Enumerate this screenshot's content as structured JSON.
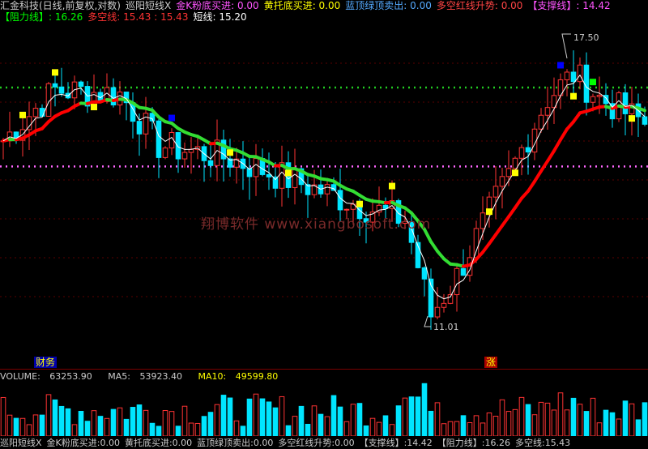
{
  "header": {
    "stock_title": "汇金科技(日线,前复权,对数)",
    "indicator_name": "巡阳短线X",
    "lines": [
      {
        "label": "金K粉底买进:",
        "value": "0.00",
        "color": "#ff55ff"
      },
      {
        "label": "黄托底买进:",
        "value": "0.00",
        "color": "#ffff00"
      },
      {
        "label": "蓝顶绿顶卖出:",
        "value": "0.00",
        "color": "#55aaff"
      },
      {
        "label": "多空红线升势:",
        "value": "0.00",
        "color": "#ff4444"
      },
      {
        "label": "【支撑线】:",
        "value": "14.42",
        "color": "#ff55ff"
      }
    ],
    "row2": [
      {
        "label": "【阻力线】:",
        "value": "16.26",
        "color": "#00ff00"
      },
      {
        "label": "多空线:",
        "value": "15.43",
        "value2": "15.43",
        "color": "#ff3333"
      },
      {
        "label": "短线:",
        "value": "15.20",
        "color": "#ffffff"
      }
    ]
  },
  "main": {
    "high_label": "17.50",
    "low_label": "11.01",
    "watermark": "翔博软件 www.xiangbosoft.com",
    "resistance_level": 16.26,
    "support_level": 14.42
  },
  "markers": {
    "left": "财务",
    "right": "涨"
  },
  "volume": {
    "label": "VOLUME:",
    "value": "63253.90",
    "ma5_label": "MA5:",
    "ma5": "53923.40",
    "ma10_label": "MA10:",
    "ma10": "49599.80"
  },
  "bottom_bar": {
    "items": [
      "巡阳短线X",
      "金K粉底买进:0.00",
      "黄托底买进:0.00",
      "蓝顶绿顶卖出:0.00",
      "多空红线升势:0.00",
      "【支撑线】:14.42",
      "【阻力线】:16.26",
      "多空线:15.43"
    ]
  },
  "colors": {
    "up": "#ff3333",
    "down": "#00e5ff",
    "resistance": "#22cc22",
    "support": "#ff66ff",
    "ema_red": "#ff0000",
    "ema_green": "#33dd33"
  }
}
